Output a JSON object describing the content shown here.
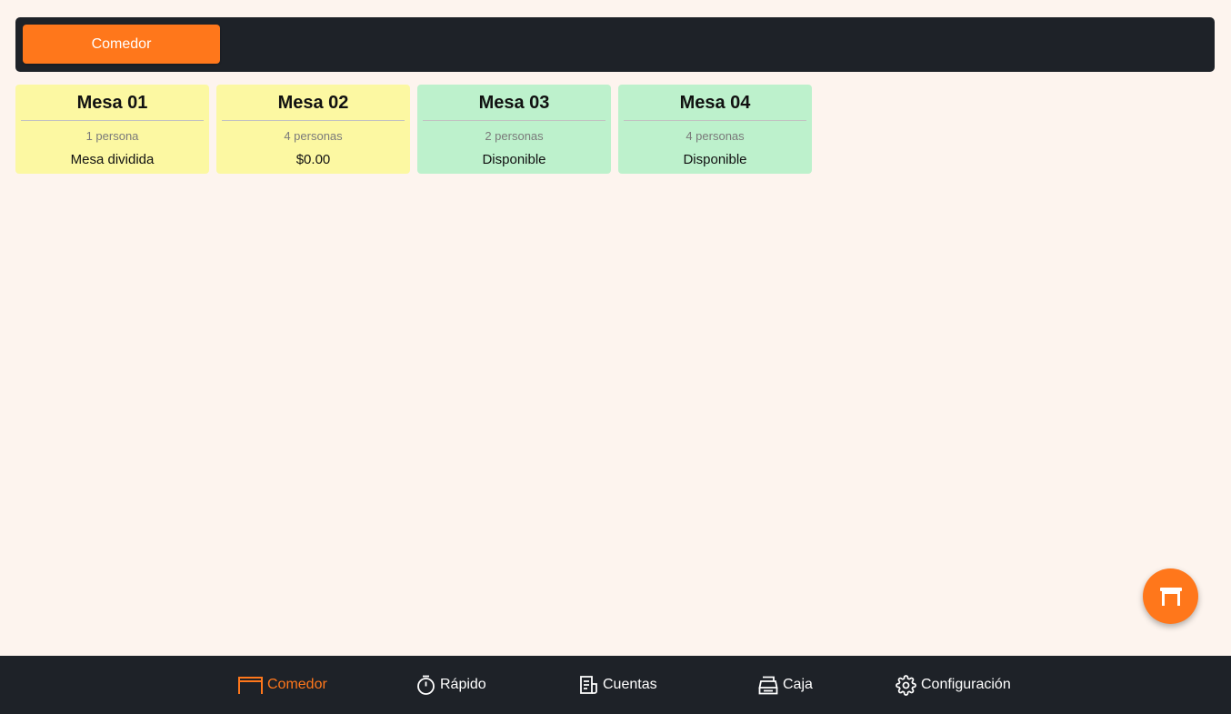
{
  "header": {
    "area_tab_label": "Comedor"
  },
  "tables": [
    {
      "name": "Mesa 01",
      "guests": "1 persona",
      "status": "Mesa dividida",
      "state": "occupied"
    },
    {
      "name": "Mesa 02",
      "guests": "4 personas",
      "status": "$0.00",
      "state": "occupied"
    },
    {
      "name": "Mesa 03",
      "guests": "2 personas",
      "status": "Disponible",
      "state": "available"
    },
    {
      "name": "Mesa 04",
      "guests": "4 personas",
      "status": "Disponible",
      "state": "available"
    }
  ],
  "fab": {
    "icon": "table-icon"
  },
  "nav": {
    "items": [
      {
        "label": "Comedor",
        "icon": "table-icon",
        "active": true
      },
      {
        "label": "Rápido",
        "icon": "stopwatch-icon",
        "active": false
      },
      {
        "label": "Cuentas",
        "icon": "receipt-icon",
        "active": false
      },
      {
        "label": "Caja",
        "icon": "cash-register-icon",
        "active": false
      },
      {
        "label": "Configuración",
        "icon": "gear-icon",
        "active": false
      }
    ]
  },
  "colors": {
    "accent": "#FF771B",
    "dark_bar": "#1E2228",
    "background": "#FDF4EE",
    "occupied": "#FCF8A2",
    "available": "#BDF1CC"
  }
}
